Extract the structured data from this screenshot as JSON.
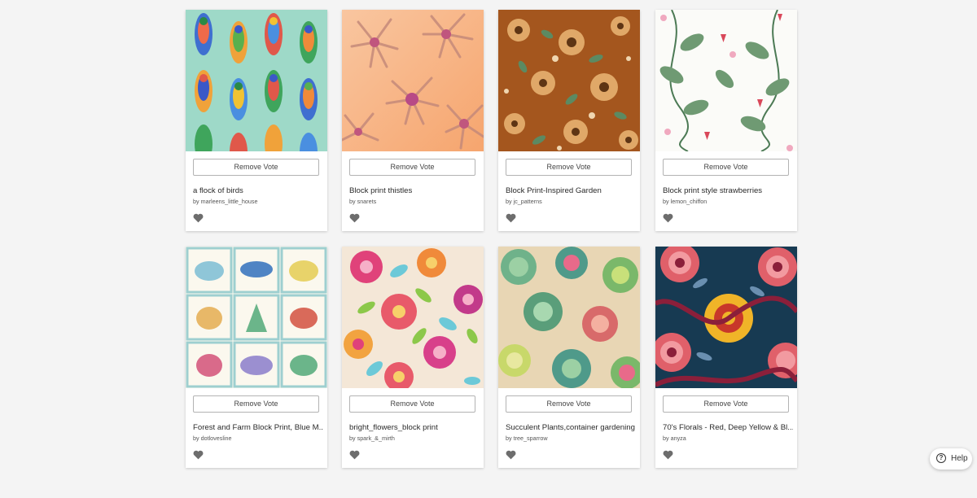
{
  "cards": [
    {
      "title": "a flock of birds",
      "by": "by",
      "author": "marleens_little_house",
      "button": "Remove Vote",
      "icon": "heart-icon"
    },
    {
      "title": "Block print thistles",
      "by": "by",
      "author": "snarets",
      "button": "Remove Vote",
      "icon": "heart-icon"
    },
    {
      "title": "Block Print-Inspired Garden",
      "by": "by",
      "author": "jc_patterns",
      "button": "Remove Vote",
      "icon": "heart-icon"
    },
    {
      "title": "Block print style strawberries",
      "by": "by",
      "author": "lemon_chiffon",
      "button": "Remove Vote",
      "icon": "heart-icon"
    },
    {
      "title": "Forest and Farm Block Print, Blue M...",
      "by": "by",
      "author": "dotlovesline",
      "button": "Remove Vote",
      "icon": "heart-icon"
    },
    {
      "title": "bright_flowers_block print",
      "by": "by",
      "author": "spark_&_mirth",
      "button": "Remove Vote",
      "icon": "heart-icon"
    },
    {
      "title": "Succulent Plants,container gardening",
      "by": "by",
      "author": "tree_sparrow",
      "button": "Remove Vote",
      "icon": "heart-icon"
    },
    {
      "title": "70's Florals - Red, Deep Yellow & Bl...",
      "by": "by",
      "author": "anyza",
      "button": "Remove Vote",
      "icon": "heart-icon"
    }
  ],
  "help": {
    "label": "Help",
    "icon": "help-circle-icon"
  },
  "colors": {
    "heart": "#6d6d6d",
    "card_bg": "#ffffff",
    "page_bg": "#f4f4f4"
  }
}
